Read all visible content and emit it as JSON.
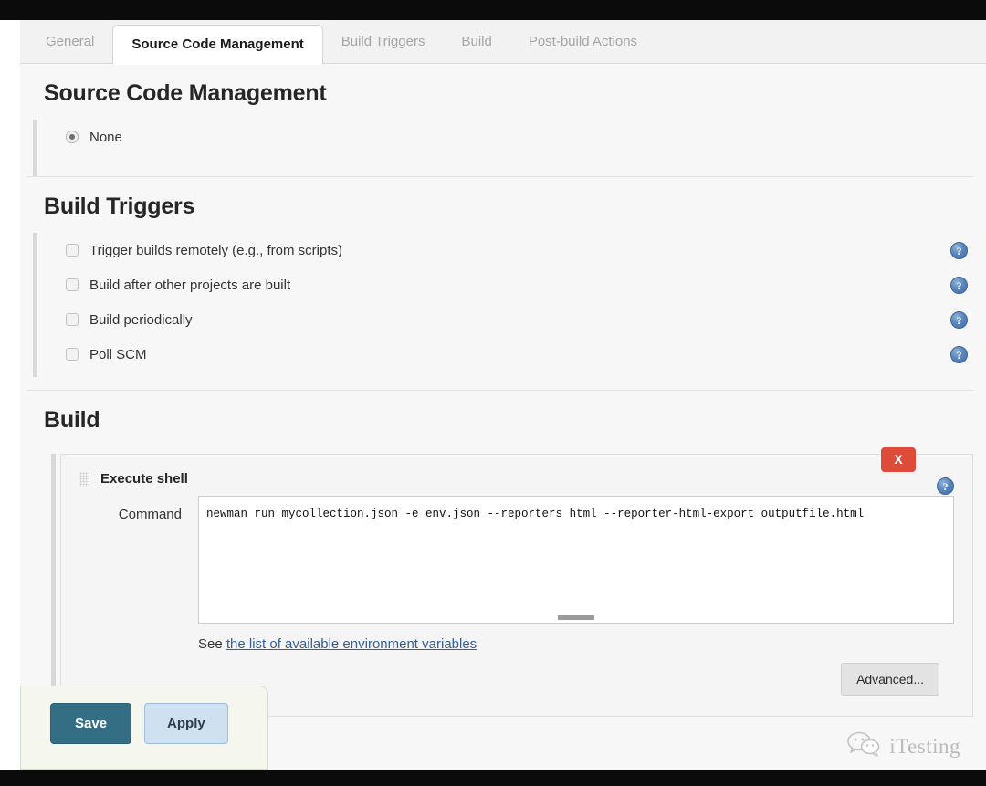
{
  "tabs": [
    {
      "label": "General",
      "active": false
    },
    {
      "label": "Source Code Management",
      "active": true
    },
    {
      "label": "Build Triggers",
      "active": false
    },
    {
      "label": "Build",
      "active": false
    },
    {
      "label": "Post-build Actions",
      "active": false
    }
  ],
  "scm": {
    "heading": "Source Code Management",
    "options": [
      {
        "label": "None",
        "selected": true
      }
    ]
  },
  "triggers": {
    "heading": "Build Triggers",
    "help_icon": "help-icon",
    "items": [
      {
        "label": "Trigger builds remotely (e.g., from scripts)",
        "checked": false
      },
      {
        "label": "Build after other projects are built",
        "checked": false
      },
      {
        "label": "Build periodically",
        "checked": false
      },
      {
        "label": "Poll SCM",
        "checked": false
      }
    ]
  },
  "build": {
    "heading": "Build",
    "step": {
      "title": "Execute shell",
      "drag_handle_icon": "drag-grip-icon",
      "delete_label": "X",
      "help_icon": "help-icon",
      "command_label": "Command",
      "command_value": "newman run mycollection.json -e env.json --reporters html --reporter-html-export outputfile.html",
      "see_prefix": "See ",
      "see_link": "the list of available environment variables",
      "advanced_label": "Advanced..."
    }
  },
  "footer": {
    "save_label": "Save",
    "apply_label": "Apply"
  },
  "watermark": {
    "logo_icon": "wechat-icon",
    "text": "iTesting"
  },
  "colors": {
    "accent_save": "#346e84",
    "accent_apply": "#cfe0f0",
    "danger": "#dd4b39",
    "link": "#355e96",
    "help": "#3f6ea8"
  }
}
